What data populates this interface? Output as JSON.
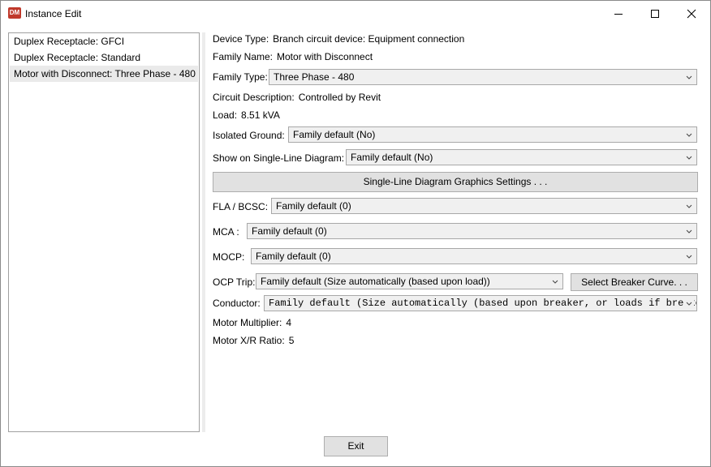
{
  "window": {
    "title": "Instance Edit",
    "app_icon_text": "DM"
  },
  "list": {
    "items": [
      {
        "label": "Duplex Receptacle: GFCI"
      },
      {
        "label": "Duplex Receptacle: Standard"
      },
      {
        "label": "Motor with Disconnect: Three Phase - 480"
      }
    ],
    "selected_index": 2
  },
  "details": {
    "device_type": {
      "label": "Device Type:",
      "value": "Branch circuit device: Equipment connection"
    },
    "family_name": {
      "label": "Family Name:",
      "value": "Motor with Disconnect"
    },
    "family_type": {
      "label": "Family Type:",
      "value": "Three Phase - 480"
    },
    "circuit_description": {
      "label": "Circuit Description:",
      "value": "Controlled by Revit"
    },
    "load": {
      "label": "Load:",
      "value": "8.51 kVA"
    },
    "isolated_ground": {
      "label": "Isolated Ground:",
      "value": "Family default (No)"
    },
    "single_line": {
      "label": "Show on Single-Line Diagram:",
      "value": "Family default (No)"
    },
    "sld_button": "Single-Line Diagram Graphics Settings . . .",
    "fla_bcsc": {
      "label": "FLA / BCSC:",
      "value": "Family default (0)"
    },
    "mca": {
      "label": "MCA :",
      "value": "Family default (0)"
    },
    "mocp": {
      "label": "MOCP:",
      "value": "Family default (0)"
    },
    "ocp_trip": {
      "label": "OCP Trip:",
      "value": "Family default (Size automatically (based upon load))"
    },
    "breaker_button": "Select Breaker Curve. . .",
    "conductor": {
      "label": "Conductor:",
      "value": "Family default (Size automatically (based upon breaker, or loads if breaker not present))"
    },
    "motor_multiplier": {
      "label": "Motor Multiplier:",
      "value": "4"
    },
    "motor_xr": {
      "label": "Motor X/R Ratio:",
      "value": "5"
    }
  },
  "footer": {
    "exit_label": "Exit"
  }
}
